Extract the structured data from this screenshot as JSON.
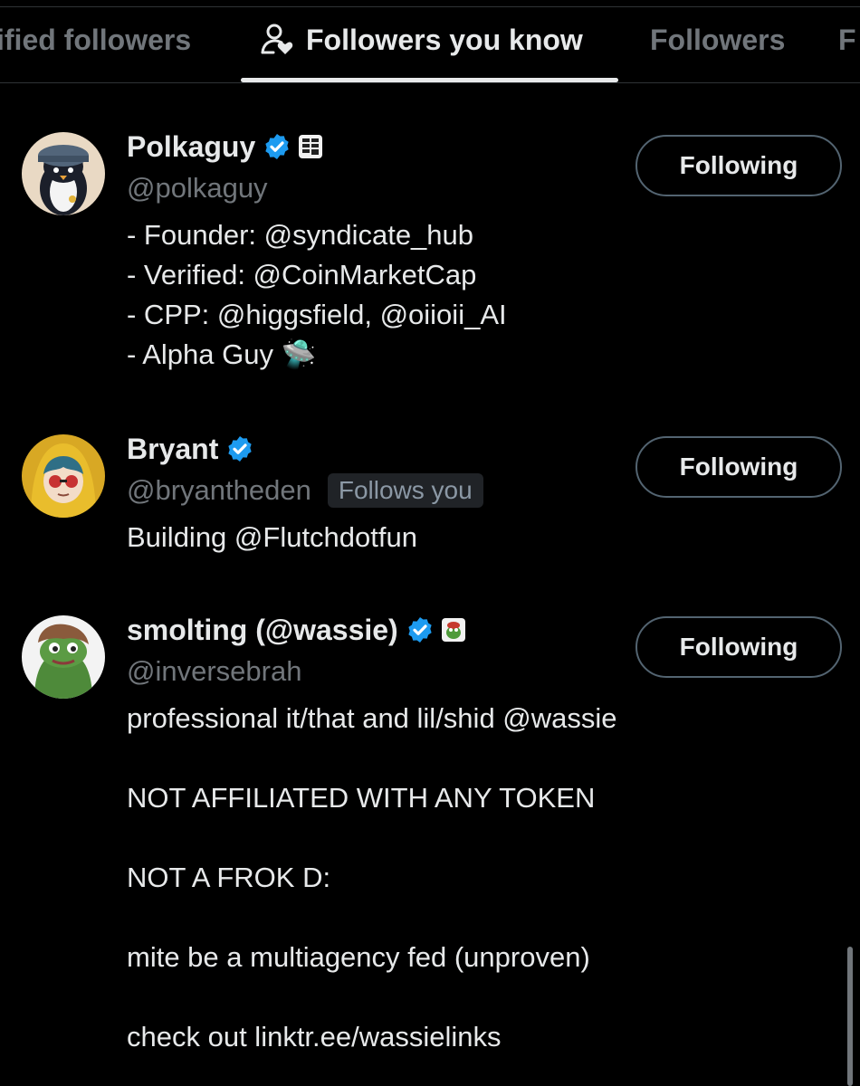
{
  "tabs": [
    {
      "label": "ified followers"
    },
    {
      "label": "Followers you know"
    },
    {
      "label": "Followers"
    },
    {
      "label": "F"
    }
  ],
  "users": [
    {
      "name": "Polkaguy",
      "handle": "@polkaguy",
      "follows_you": "",
      "bio": "- Founder: @syndicate_hub\n- Verified: @CoinMarketCap\n- CPP: @higgsfield, @oiioii_AI\n- Alpha Guy 🛸",
      "button": "Following"
    },
    {
      "name": "Bryant",
      "handle": "@bryantheden",
      "follows_you": "Follows you",
      "bio": "Building @Flutchdotfun",
      "button": "Following"
    },
    {
      "name": "smolting (@wassie)",
      "handle": "@inversebrah",
      "follows_you": "",
      "bio": "professional it/that and lil/shid @wassie\n\nNOT AFFILIATED WITH ANY TOKEN\n\nNOT A FROK D:\n\nmite be a multiagency fed (unproven)\n\ncheck out linktr.ee/wassielinks",
      "button": "Following"
    }
  ],
  "colors": {
    "background": "#000000",
    "text": "#e7e9ea",
    "secondary": "#71767b",
    "verified": "#1d9bf0",
    "border": "#2f3336"
  },
  "icons": {
    "active_tab": "person-heart-icon",
    "verified": "verified-badge-icon"
  }
}
